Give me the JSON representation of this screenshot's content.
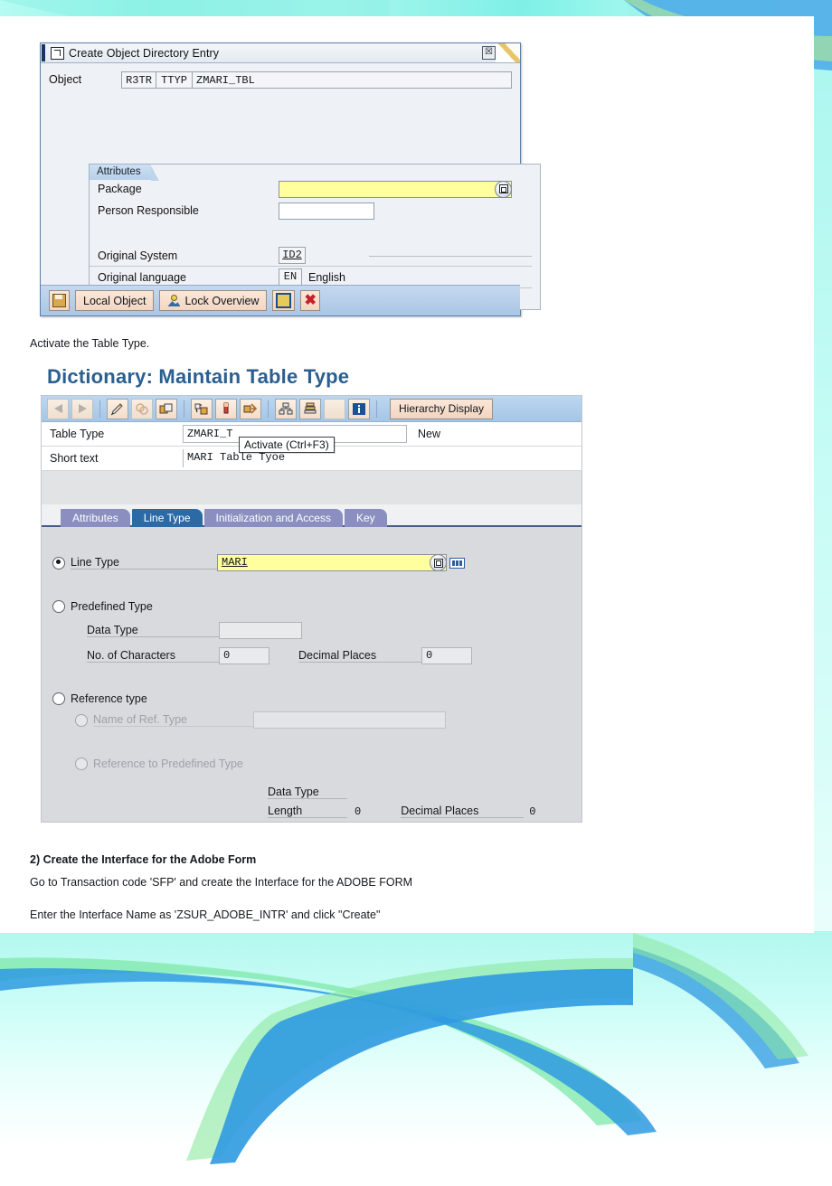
{
  "dialog": {
    "title": "Create Object Directory Entry",
    "close_label": "☒",
    "object_label": "Object",
    "object_type": "R3TR",
    "object_subtype": "TTYP",
    "object_name": "ZMARI_TBL",
    "attributes_tab": "Attributes",
    "package_label": "Package",
    "package_value": "",
    "person_label": "Person Responsible",
    "person_value": "",
    "original_system_label": "Original System",
    "original_system_value": "ID2",
    "original_language_label": "Original language",
    "original_language_code": "EN",
    "original_language_name": "English",
    "buttons": {
      "local_object": "Local Object",
      "lock_overview": "Lock Overview"
    }
  },
  "notes": {
    "activate": "Activate the Table Type.",
    "step_heading": "2) Create the Interface for the Adobe Form",
    "step_line1": "Go to Transaction code 'SFP' and create the Interface for the ADOBE FORM",
    "step_line2": "Enter the Interface Name as 'ZSUR_ADOBE_INTR' and click \"Create\""
  },
  "dictionary": {
    "title": "Dictionary: Maintain Table Type",
    "toolbar": {
      "hierarchy_display": "Hierarchy Display"
    },
    "tooltip": "Activate  (Ctrl+F3)",
    "table_type_label": "Table Type",
    "table_type_value": "ZMARI_T",
    "status": "New",
    "short_text_label": "Short text",
    "short_text_value": "MARI Table Tyoe",
    "tabs": [
      {
        "label": "Attributes",
        "selected": false
      },
      {
        "label": "Line Type",
        "selected": true
      },
      {
        "label": "Initialization and Access",
        "selected": false
      },
      {
        "label": "Key",
        "selected": false
      }
    ],
    "line_type_label": "Line Type",
    "line_type_value": "MARI",
    "predefined_type_label": "Predefined Type",
    "data_type_label": "Data Type",
    "data_type_value": "",
    "no_of_characters_label": "No. of Characters",
    "no_of_characters_value": "0",
    "decimal_places_label": "Decimal Places",
    "decimal_places_value": "0",
    "reference_type_label": "Reference type",
    "name_of_ref_type_label": "Name of Ref. Type",
    "name_of_ref_type_value": "",
    "reference_to_predefined_label": "Reference to Predefined Type",
    "ref_data_type_label": "Data Type",
    "ref_length_label": "Length",
    "ref_length_value": "0",
    "ref_decimal_places_label": "Decimal Places",
    "ref_decimal_places_value": "0"
  },
  "colors": {
    "accent_blue": "#2a5f8f",
    "tab_selected": "#2c6aa5",
    "tab_normal": "#8b8fc0",
    "input_yellow": "#ffff9e",
    "toolbar_blue": "#a5c6e6"
  }
}
